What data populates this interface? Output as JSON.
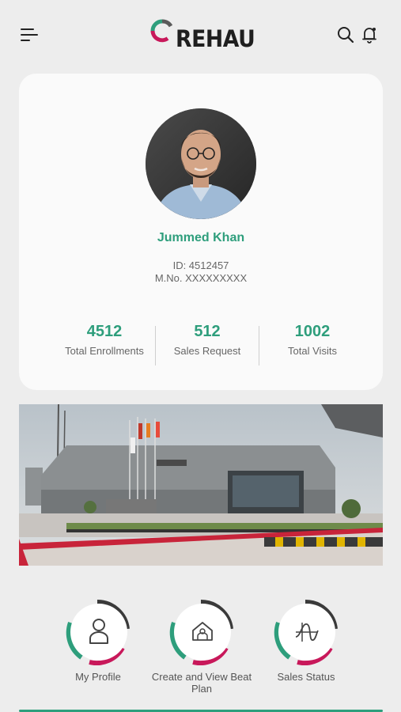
{
  "header": {
    "brand": "REHAU",
    "colors": {
      "green": "#2e9e7c",
      "magenta": "#c8185a",
      "dark": "#222222"
    },
    "icons": {
      "menu": "menu-icon",
      "search": "search-icon",
      "notifications": "bell-icon"
    }
  },
  "profile": {
    "name": "Jummed Khan",
    "id_text": "ID: 4512457",
    "mobile_text": "M.No. XXXXXXXXX",
    "stats": [
      {
        "value": "4512",
        "label": "Total Enrollments"
      },
      {
        "value": "512",
        "label": "Sales Request"
      },
      {
        "value": "1002",
        "label": "Total Visits"
      }
    ]
  },
  "quick_actions": [
    {
      "label": "My Profile",
      "icon": "person-icon"
    },
    {
      "label": "Create and View Beat Plan",
      "icon": "house-plan-icon"
    },
    {
      "label": "Sales Status",
      "icon": "sales-status-icon"
    }
  ]
}
